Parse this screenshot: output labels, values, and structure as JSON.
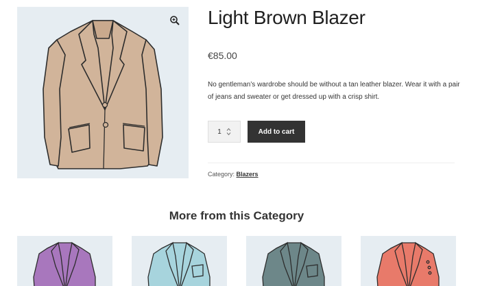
{
  "product": {
    "title": "Light Brown Blazer",
    "price": "€85.00",
    "description": "No gentleman’s wardrobe should be without a tan leather blazer. Wear it with a pair of jeans and sweater or get dressed up with a crisp shirt.",
    "quantity": "1",
    "add_to_cart_label": "Add to cart",
    "category_label": "Category:",
    "category_value": "Blazers",
    "image_color": "#d1b49a",
    "zoom_icon": "zoom-in-icon"
  },
  "related": {
    "heading": "More from this Category",
    "items": [
      {
        "color": "#a877bd"
      },
      {
        "color": "#a7d4dd"
      },
      {
        "color": "#6d8789"
      },
      {
        "color": "#e87a6a"
      }
    ]
  },
  "colors": {
    "button_bg": "#333333",
    "image_bg": "#e6edf2"
  }
}
